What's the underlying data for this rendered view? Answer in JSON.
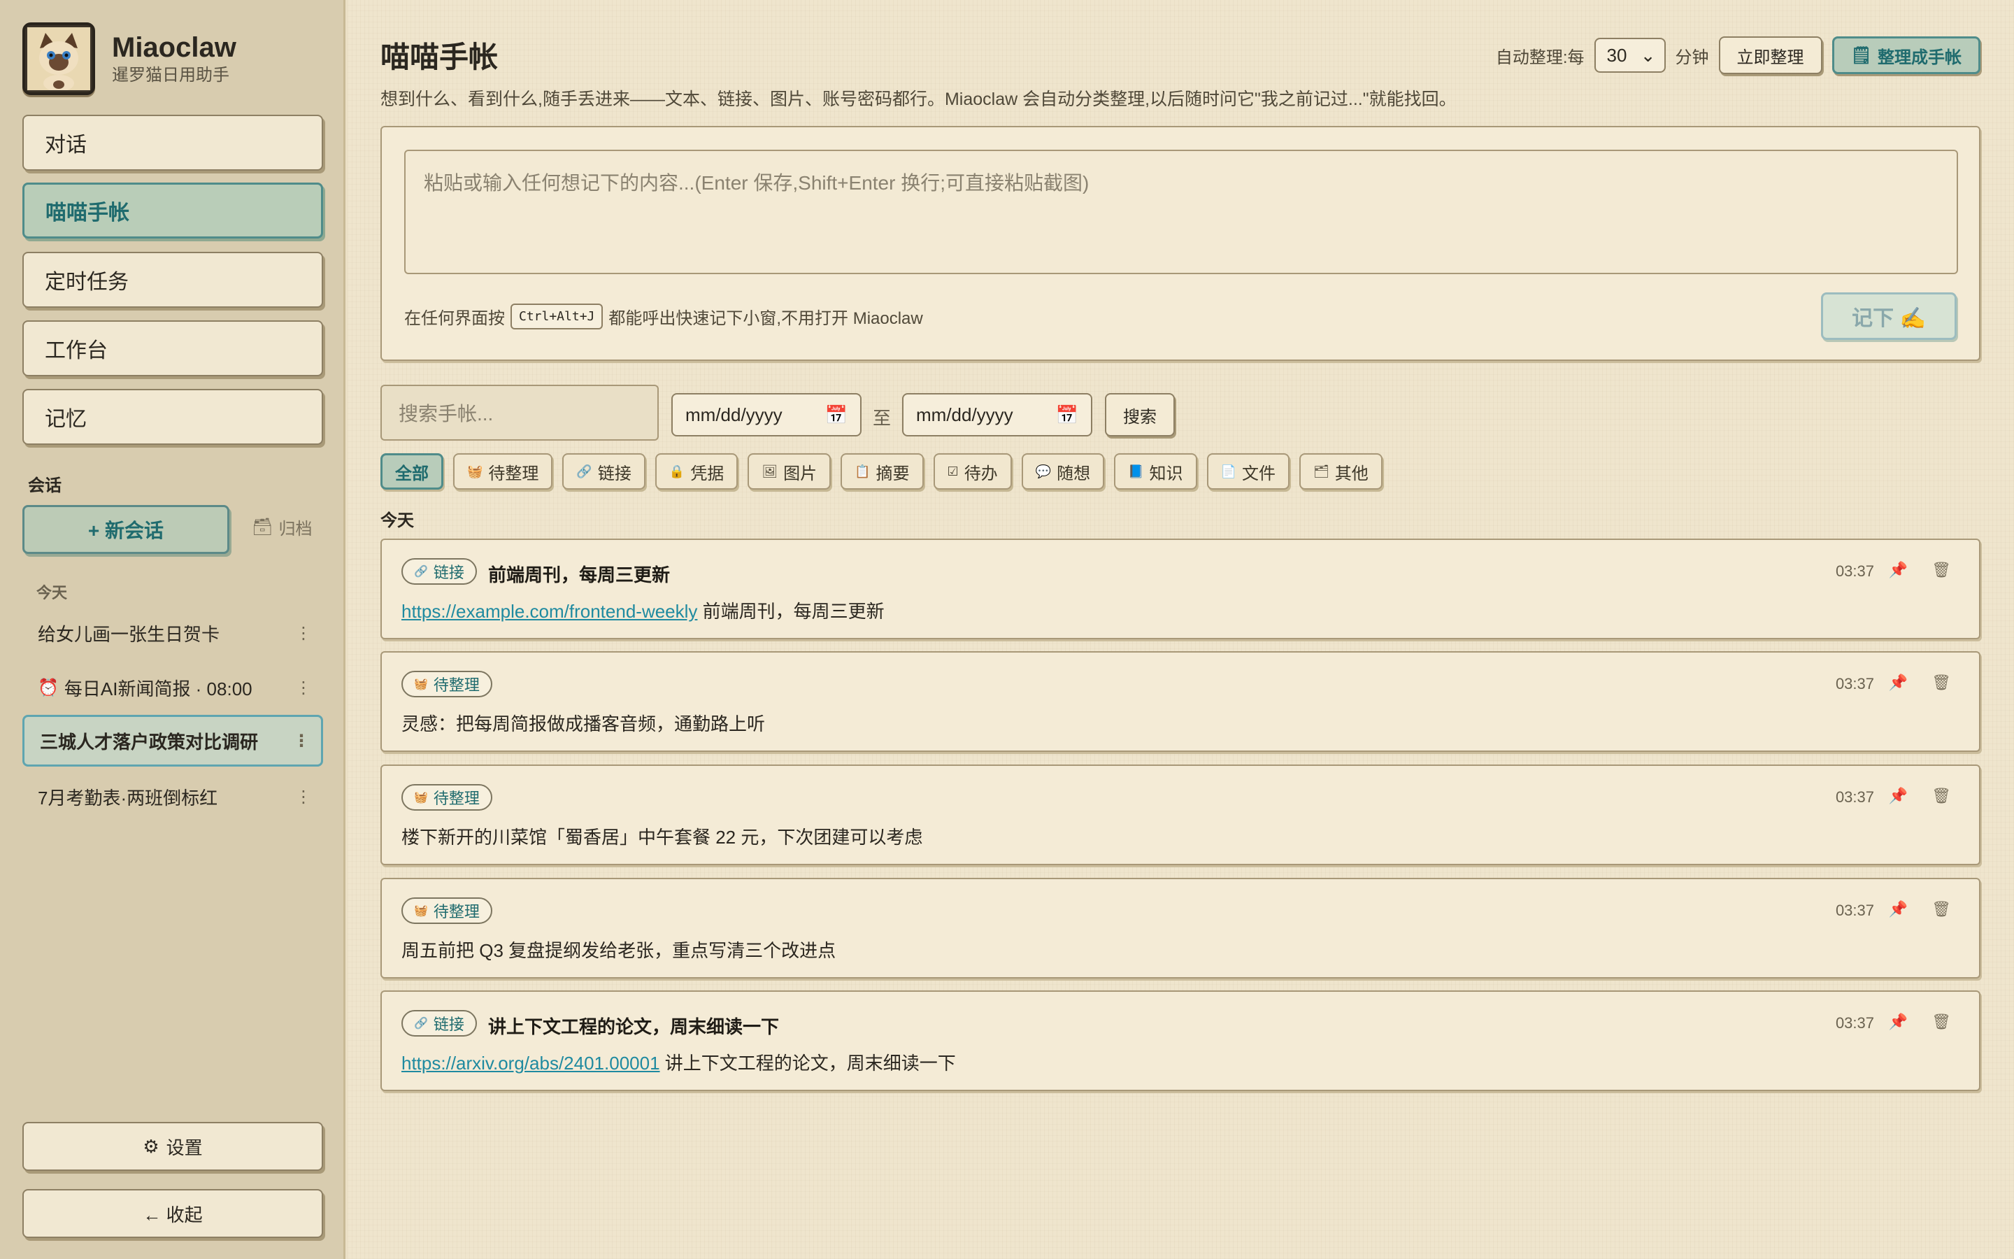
{
  "app": {
    "name": "Miaoclaw",
    "subtitle": "暹罗猫日用助手"
  },
  "nav": [
    {
      "label": "对话",
      "active": false
    },
    {
      "label": "喵喵手帐",
      "active": true
    },
    {
      "label": "定时任务",
      "active": false
    },
    {
      "label": "工作台",
      "active": false
    },
    {
      "label": "记忆",
      "active": false
    }
  ],
  "sessions": {
    "section_label": "会话",
    "new_label": "+ 新会话",
    "archive_label": "归档",
    "group_today": "今天",
    "items": [
      {
        "label": "给女儿画一张生日贺卡",
        "scheduled": false,
        "active": false
      },
      {
        "label": "每日AI新闻简报 · 08:00",
        "scheduled": true,
        "active": false
      },
      {
        "label": "三城人才落户政策对比调研",
        "scheduled": false,
        "active": true
      },
      {
        "label": "7月考勤表·两班倒标红",
        "scheduled": false,
        "active": false
      }
    ],
    "more_glyph": "⋮"
  },
  "footer": {
    "settings_label": "设置",
    "collapse_label": "← 收起"
  },
  "page": {
    "title": "喵喵手帐",
    "description": "想到什么、看到什么,随手丢进来——文本、链接、图片、账号密码都行。Miaoclaw 会自动分类整理,以后随时问它\"我之前记过...\"就能找回。",
    "auto_label": "自动整理:每",
    "auto_value": "30",
    "auto_unit": "分钟",
    "organize_now": "立即整理",
    "make_notebook": "整理成手帐"
  },
  "compose": {
    "placeholder": "粘贴或输入任何想记下的内容...(Enter 保存,Shift+Enter 换行;可直接粘贴截图)",
    "hint_before": "在任何界面按",
    "shortcut": "Ctrl+Alt+J",
    "hint_after": "都能呼出快速记下小窗,不用打开 Miaoclaw",
    "save_label": "记下 ✍️"
  },
  "search": {
    "placeholder": "搜索手帐...",
    "date_from": "mm/dd/yyyy",
    "to_label": "至",
    "date_to": "mm/dd/yyyy",
    "button": "搜索"
  },
  "filters": [
    {
      "label": "全部",
      "icon": "",
      "active": true
    },
    {
      "label": "待整理",
      "icon": "🧺",
      "active": false
    },
    {
      "label": "链接",
      "icon": "🔗",
      "active": false
    },
    {
      "label": "凭据",
      "icon": "🔒",
      "active": false
    },
    {
      "label": "图片",
      "icon": "🖼",
      "active": false
    },
    {
      "label": "摘要",
      "icon": "📋",
      "active": false
    },
    {
      "label": "待办",
      "icon": "☑",
      "active": false
    },
    {
      "label": "随想",
      "icon": "💬",
      "active": false
    },
    {
      "label": "知识",
      "icon": "📘",
      "active": false
    },
    {
      "label": "文件",
      "icon": "📄",
      "active": false
    },
    {
      "label": "其他",
      "icon": "🗂",
      "active": false
    }
  ],
  "day_label": "今天",
  "notes": [
    {
      "tag": "链接",
      "tag_icon": "🔗",
      "title": "前端周刊，每周三更新",
      "link": "https://example.com/frontend-weekly",
      "text": "前端周刊，每周三更新",
      "time": "03:37"
    },
    {
      "tag": "待整理",
      "tag_icon": "🧺",
      "title": "",
      "link": "",
      "text": "灵感：把每周简报做成播客音频，通勤路上听",
      "time": "03:37"
    },
    {
      "tag": "待整理",
      "tag_icon": "🧺",
      "title": "",
      "link": "",
      "text": "楼下新开的川菜馆「蜀香居」中午套餐 22 元，下次团建可以考虑",
      "time": "03:37"
    },
    {
      "tag": "待整理",
      "tag_icon": "🧺",
      "title": "",
      "link": "",
      "text": "周五前把 Q3 复盘提纲发给老张，重点写清三个改进点",
      "time": "03:37"
    },
    {
      "tag": "链接",
      "tag_icon": "🔗",
      "title": "讲上下文工程的论文，周末细读一下",
      "link": "https://arxiv.org/abs/2401.00001",
      "text": "讲上下文工程的论文，周末细读一下",
      "time": "03:37"
    }
  ]
}
